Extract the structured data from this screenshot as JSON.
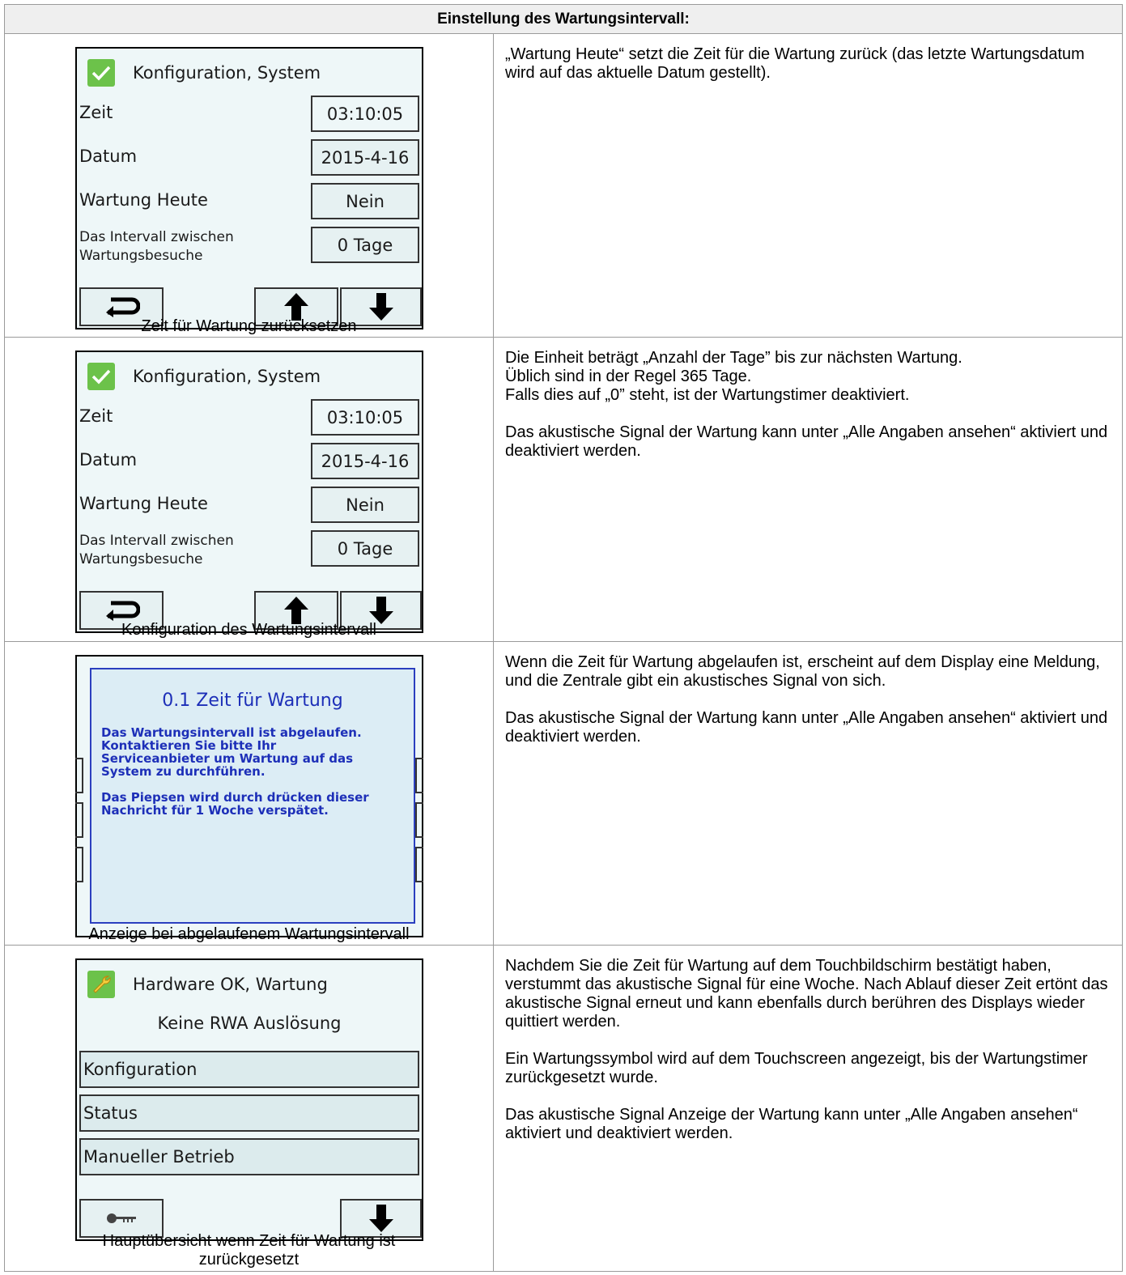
{
  "heading": "Einstellung des Wartungsintervall:",
  "rows": [
    {
      "screen": {
        "title": "Konfiguration, System",
        "fields": [
          {
            "label": "Zeit",
            "value": "03:10:05"
          },
          {
            "label": "Datum",
            "value": "2015-4-16"
          },
          {
            "label": "Wartung Heute",
            "value": "Nein"
          },
          {
            "label_line1": "Das Intervall zwischen",
            "label_line2": "Wartungsbesuche",
            "value": "0 Tage"
          }
        ]
      },
      "caption": "Zeit für Wartung zurücksetzen",
      "desc": [
        "„Wartung Heute“ setzt die Zeit für die Wartung zurück (das letzte Wartungsdatum wird auf das aktuelle Datum gestellt)."
      ]
    },
    {
      "screen": {
        "title": "Konfiguration, System",
        "fields": [
          {
            "label": "Zeit",
            "value": "03:10:05"
          },
          {
            "label": "Datum",
            "value": "2015-4-16"
          },
          {
            "label": "Wartung Heute",
            "value": "Nein"
          },
          {
            "label_line1": "Das Intervall zwischen",
            "label_line2": "Wartungsbesuche",
            "value": "0 Tage"
          }
        ]
      },
      "caption": "Konfiguration des Wartungsintervall",
      "desc": [
        "Die Einheit beträgt „Anzahl der Tage” bis zur nächsten Wartung.\nÜblich sind in der Regel 365 Tage.\nFalls dies auf „0” steht, ist der Wartungstimer deaktiviert.",
        "Das akustische Signal der Wartung kann unter „Alle Angaben ansehen“ aktiviert und deaktiviert werden."
      ]
    },
    {
      "popup": {
        "title": "0.1 Zeit für Wartung",
        "body": " Das Wartungsintervall ist abgelaufen.\n Kontaktieren Sie bitte Ihr\nServiceanbieter um Wartung auf das\nSystem zu durchführen.\n\n Das Piepsen wird durch drücken dieser\nNachricht für 1 Woche verspätet."
      },
      "caption": "Anzeige bei abgelaufenem Wartungsintervall",
      "desc": [
        "Wenn die Zeit für Wartung abgelaufen ist, erscheint auf dem Display eine Meldung, und die Zentrale gibt ein akustisches Signal von sich.",
        "Das akustische Signal der Wartung kann unter „Alle Angaben ansehen“ aktiviert und deaktiviert werden."
      ]
    },
    {
      "screen": {
        "title": "Hardware OK, Wartung",
        "subtitle": "Keine RWA Auslösung",
        "menu": [
          "Konfiguration",
          "Status",
          "Manueller Betrieb"
        ]
      },
      "caption_line1": "Hauptübersicht wenn Zeit für Wartung ist",
      "caption_line2": "zurückgesetzt",
      "desc": [
        "Nachdem Sie die Zeit für Wartung auf dem Touchbildschirm bestätigt haben, verstummt das akustische Signal für eine Woche. Nach Ablauf dieser Zeit ertönt das akustische Signal erneut und kann ebenfalls durch berühren des Displays wieder quittiert werden.",
        "Ein Wartungssymbol wird auf dem Touchscreen angezeigt, bis der Wartungstimer zurückgesetzt wurde.",
        "Das akustische Signal Anzeige der Wartung kann unter „Alle Angaben ansehen“ aktiviert und deaktiviert werden."
      ]
    }
  ],
  "colors": {
    "check_green": "#6cc24a",
    "popup_text": "#1d2fb8",
    "screen_bg": "#eef7f8"
  },
  "icons": [
    "check-icon",
    "return-arrow-icon",
    "arrow-up-icon",
    "arrow-down-icon",
    "wrench-icon",
    "key-icon"
  ]
}
